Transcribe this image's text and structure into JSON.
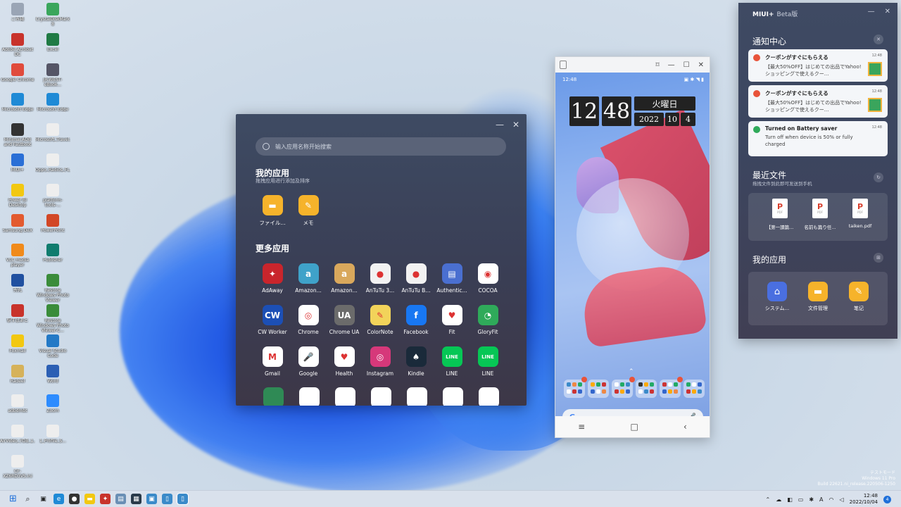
{
  "desktop": {
    "icons": [
      {
        "label": "ごみ箱",
        "color": "#9aa5b5"
      },
      {
        "label": "CrystalDiskMark 8",
        "color": "#3aa65c"
      },
      {
        "label": "Adobe Acrobat DC",
        "color": "#c8332b"
      },
      {
        "label": "Excel",
        "color": "#1f7a44"
      },
      {
        "label": "Google Chrome",
        "color": "#e04b3c"
      },
      {
        "label": "JR-WEST-eBook...",
        "color": "#556"
      },
      {
        "label": "Microsoft Edge",
        "color": "#1f8ad6"
      },
      {
        "label": "Microsoft Edge",
        "color": "#1f8ad6"
      },
      {
        "label": "Minimal ADB and Fastboot",
        "color": "#333"
      },
      {
        "label": "Microsoft_Travel...",
        "color": "#eee"
      },
      {
        "label": "MIUI+",
        "color": "#2a6fd6"
      },
      {
        "label": "Oppo_Radios_FL...",
        "color": "#eee"
      },
      {
        "label": "Power BI Desktop",
        "color": "#f2c811"
      },
      {
        "label": "platform-tools-...",
        "color": "#eee"
      },
      {
        "label": "Samsung DeX",
        "color": "#e35a2f"
      },
      {
        "label": "PowerPoint",
        "color": "#d24726"
      },
      {
        "label": "VLC media player",
        "color": "#f08a1a"
      },
      {
        "label": "Publisher",
        "color": "#107c6e"
      },
      {
        "label": "秀丸",
        "color": "#2050a0"
      },
      {
        "label": "Restore Windows Photo Viewer",
        "color": "#3a8c3a"
      },
      {
        "label": "駅すぱあと",
        "color": "#c8332b"
      },
      {
        "label": "Restore Windows Photo Viewer-C...",
        "color": "#3a8c3a"
      },
      {
        "label": "Foxmail",
        "color": "#f2c811"
      },
      {
        "label": "Visual Studio Code",
        "color": "#2379c6"
      },
      {
        "label": "Radeel",
        "color": "#d6b25a"
      },
      {
        "label": "Word",
        "color": "#2b5fb4"
      },
      {
        "label": "adbdmbt",
        "color": "#eee"
      },
      {
        "label": "Zoom",
        "color": "#2d8cff"
      },
      {
        "label": "AirVideo_YDB_1...",
        "color": "#eee"
      },
      {
        "label": "1_Profile_S...",
        "color": "#eee"
      },
      {
        "label": "CF-XZ6RD3VS.ini",
        "color": "#eee"
      }
    ]
  },
  "launcher": {
    "search_placeholder": "输入应用名称开始搜索",
    "my_apps_title": "我的应用",
    "my_apps_sub": "拖拽应用进行添加及排序",
    "more_apps_title": "更多应用",
    "minimize": "—",
    "close": "✕",
    "my_apps": [
      {
        "label": "ファイル...",
        "color": "#f6b32b",
        "glyph": "▬"
      },
      {
        "label": "メモ",
        "color": "#f6b32b",
        "glyph": "✎"
      }
    ],
    "more_apps": [
      {
        "label": "AdAway",
        "color": "#c9252c",
        "glyph": "✦"
      },
      {
        "label": "Amazon...",
        "color": "#3fa2c9",
        "glyph": "a"
      },
      {
        "label": "Amazon...",
        "color": "#d9a85c",
        "glyph": "a"
      },
      {
        "label": "AnTuTu 3...",
        "color": "#f2f2f2",
        "glyph": "●"
      },
      {
        "label": "AnTuTu B...",
        "color": "#f2f2f2",
        "glyph": "●"
      },
      {
        "label": "Authentic...",
        "color": "#4a6fd0",
        "glyph": "▤"
      },
      {
        "label": "COCOA",
        "color": "#ffffff",
        "glyph": "◉"
      },
      {
        "label": "CW Worker",
        "color": "#1c4fb5",
        "glyph": "CW"
      },
      {
        "label": "Chrome",
        "color": "#ffffff",
        "glyph": "◎"
      },
      {
        "label": "Chrome UA",
        "color": "#6b6b6b",
        "glyph": "UA"
      },
      {
        "label": "ColorNote",
        "color": "#f2d35a",
        "glyph": "✎"
      },
      {
        "label": "Facebook",
        "color": "#1877f2",
        "glyph": "f"
      },
      {
        "label": "Fit",
        "color": "#ffffff",
        "glyph": "♥"
      },
      {
        "label": "GloryFit",
        "color": "#2faa5a",
        "glyph": "◔"
      },
      {
        "label": "Gmail",
        "color": "#ffffff",
        "glyph": "M"
      },
      {
        "label": "Google",
        "color": "#ffffff",
        "glyph": "🎤"
      },
      {
        "label": "Health",
        "color": "#ffffff",
        "glyph": "♥"
      },
      {
        "label": "Instagram",
        "color": "#d6387a",
        "glyph": "◎"
      },
      {
        "label": "Kindle",
        "color": "#1a2a3a",
        "glyph": "♠"
      },
      {
        "label": "LINE",
        "color": "#06c755",
        "glyph": "LINE"
      },
      {
        "label": "LINE",
        "color": "#06c755",
        "glyph": "LINE"
      }
    ]
  },
  "phone": {
    "status_time": "12:48",
    "status_icons": "▣ ✱ ◥ ▮",
    "clock_hour": "12",
    "clock_min": "48",
    "weekday": "火曜日",
    "year": "2022",
    "month": "10",
    "day": "4",
    "google_g": "G",
    "mic": "🎤",
    "nav_menu": "≡",
    "nav_home": "□",
    "nav_back": "‹"
  },
  "miui": {
    "title": "MIUI+",
    "beta": "Beta版",
    "minimize": "—",
    "close": "✕",
    "notif_title": "通知中心",
    "notifications": [
      {
        "title": "クーポンがすぐにもらえる",
        "body": "【最大50%OFF】はじめての出品でYahoo!ショッピングで使えるクー...",
        "time": "12:48",
        "icon_color": "#e8533a"
      },
      {
        "title": "クーポンがすぐにもらえる",
        "body": "【最大50%OFF】はじめての出品でYahoo!ショッピングで使えるクー...",
        "time": "12:48",
        "icon_color": "#e8533a"
      },
      {
        "title": "Turned on Battery saver",
        "body": "Turn off when device is 50% or fully charged",
        "time": "12:48",
        "icon_color": "#2faa5a"
      }
    ],
    "files_title": "最近文件",
    "files_sub": "拖拽文件到此即可发送到手机",
    "files": [
      {
        "name": "【第一讀篇..."
      },
      {
        "name": "名前も篇り任..."
      },
      {
        "name": "taiken.pdf"
      }
    ],
    "pdf_tag": "PDF",
    "pdf_letter": "P",
    "apps_title": "我的应用",
    "apps": [
      {
        "label": "システム...",
        "color": "#4a6fe0",
        "glyph": "⌂"
      },
      {
        "label": "文件管理",
        "color": "#f6b32b",
        "glyph": "▬"
      },
      {
        "label": "笔记",
        "color": "#f6b32b",
        "glyph": "✎"
      }
    ]
  },
  "taskbar": {
    "time": "12:48",
    "date": "2022/10/04",
    "lang": "A",
    "badge": "4"
  },
  "watermark": {
    "line1": "テストモード",
    "line2": "Windows 11 Pro",
    "line3": "Build 22621.ni_release.220506-1250"
  }
}
